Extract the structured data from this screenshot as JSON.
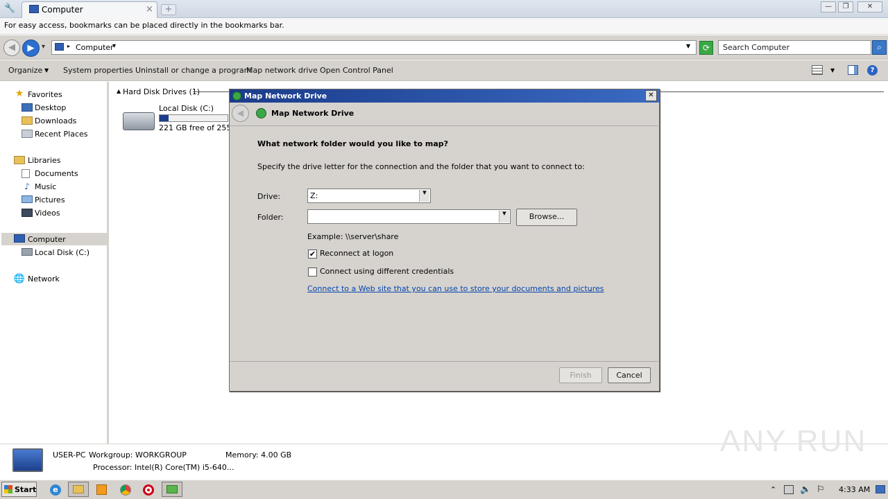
{
  "browser": {
    "tab_title": "Computer",
    "tab_close": "×",
    "new_tab": "+",
    "bookmarks_message": "For easy access, bookmarks can be placed directly in the bookmarks bar.",
    "window_controls": {
      "minimize": "—",
      "restore": "❐",
      "close": "✕"
    }
  },
  "nav": {
    "address_label": "Computer",
    "address_chevron": "▾",
    "dropdown_arrow": "▼",
    "search_placeholder": "Search Computer"
  },
  "commands": {
    "organize": "Organize",
    "system_properties": "System properties",
    "uninstall": "Uninstall or change a program",
    "map_drive": "Map network drive",
    "control_panel": "Open Control Panel"
  },
  "sidebar": {
    "favorites": "Favorites",
    "desktop": "Desktop",
    "downloads": "Downloads",
    "recent": "Recent Places",
    "libraries": "Libraries",
    "documents": "Documents",
    "music": "Music",
    "pictures": "Pictures",
    "videos": "Videos",
    "computer": "Computer",
    "local_disk": "Local Disk (C:)",
    "network": "Network"
  },
  "content": {
    "group_header": "Hard Disk Drives (1)",
    "drive_name": "Local Disk (C:)",
    "drive_free": "221 GB free of 255 G",
    "drive_used_fraction": 0.13
  },
  "details": {
    "pc_name": "USER-PC",
    "workgroup": "Workgroup: WORKGROUP",
    "memory": "Memory: 4.00 GB",
    "processor": "Processor: Intel(R) Core(TM) i5-640..."
  },
  "dialog": {
    "title": "Map Network Drive",
    "header": "Map Network Drive",
    "close": "✕",
    "question": "What network folder would you like to map?",
    "instructions": "Specify the drive letter for the connection and the folder that you want to connect to:",
    "drive_label": "Drive:",
    "drive_value": "Z:",
    "folder_label": "Folder:",
    "folder_value": "",
    "browse": "Browse...",
    "example": "Example: \\\\server\\share",
    "reconnect": "Reconnect at logon",
    "reconnect_checked": "✔",
    "credentials": "Connect using different credentials",
    "link_text": "Connect to a Web site that you can use to store your documents and pictures",
    "link_period": ".",
    "finish": "Finish",
    "cancel": "Cancel"
  },
  "taskbar": {
    "start": "Start",
    "clock": "4:33 AM",
    "tray_arrow": "⌃"
  },
  "watermark": "ANY RUN",
  "colors": {
    "titlebar": "#1b3c8b",
    "link": "#0645ad",
    "window_bg": "#d6d3ce"
  }
}
